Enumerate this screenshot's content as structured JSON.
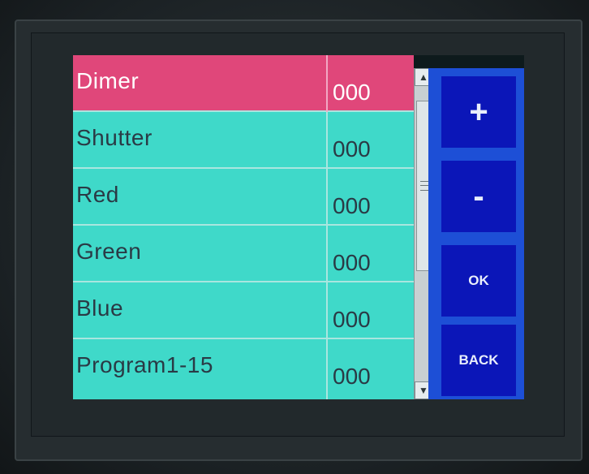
{
  "channels": [
    {
      "name": "Dimer",
      "value": "000",
      "selected": true
    },
    {
      "name": "Shutter",
      "value": "000",
      "selected": false
    },
    {
      "name": "Red",
      "value": "000",
      "selected": false
    },
    {
      "name": "Green",
      "value": "000",
      "selected": false
    },
    {
      "name": "Blue",
      "value": "000",
      "selected": false
    },
    {
      "name": "Program1-15",
      "value": "000",
      "selected": false
    }
  ],
  "controls": {
    "plus_label": "+",
    "minus_label": "-",
    "ok_label": "OK",
    "back_label": "BACK"
  },
  "scroll": {
    "up_icon": "arrow-up-icon",
    "down_icon": "arrow-down-icon"
  },
  "colors": {
    "row_bg": "#3fd9c9",
    "selected_bg": "#e0477a",
    "button_panel": "#1d4fd6",
    "button_bg": "#0b16b8"
  }
}
